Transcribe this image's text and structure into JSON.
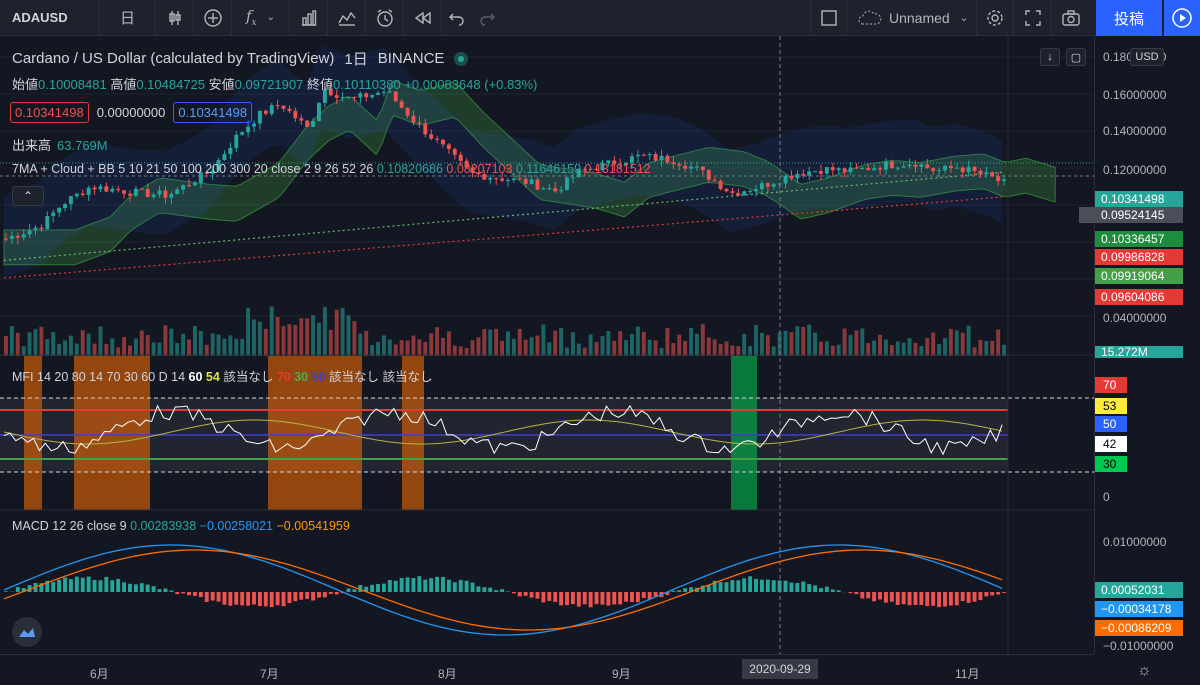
{
  "toolbar": {
    "symbol": "ADAUSD",
    "interval_icon": "日",
    "layout_name": "Unnamed",
    "post_label": "投稿"
  },
  "legend": {
    "title": "Cardano / US Dollar (calculated by TradingView)",
    "interval": "1日",
    "exchange": "BINANCE",
    "open_label": "始値",
    "open": "0.10008481",
    "high_label": "高値",
    "high": "0.10484725",
    "low_label": "安値",
    "low": "0.09721907",
    "close_label": "終値",
    "close": "0.10110380",
    "change": "+0.00083648 (+0.83%)",
    "bid": "0.10341498",
    "spread": "0.00000000",
    "ask": "0.10341498",
    "volume_label": "出来高",
    "volume": "63.769M",
    "indicator_name": "7MA + Cloud + BB 5 10 21 50 100 200 300 20 close 2 9 26 52 26",
    "ind_v1": "0.10820686",
    "ind_v2": "0.08207103",
    "ind_v3": "0.11646159",
    "ind_v4": "0.13181512",
    "collapse_icon": "chevron-up-icon"
  },
  "mfi": {
    "name": "MFI 14 20 80 14 70 30 60 D 14",
    "v60": "60",
    "v54": "54",
    "na1": "該当なし",
    "v70": "70",
    "v30": "30",
    "v50": "50",
    "na2": "該当なし",
    "na3": "該当なし",
    "tags": [
      "70",
      "53",
      "50",
      "42",
      "30"
    ],
    "zero": "0"
  },
  "macd": {
    "name": "MACD 12 26 close 9",
    "v1": "0.00283938",
    "v2": "−0.00258021",
    "v3": "−0.00541959",
    "axis": [
      "0.01000000",
      "−0.01000000"
    ],
    "tags": [
      "0.00052031",
      "−0.00034178",
      "−0.00086209"
    ]
  },
  "price_axis": {
    "currency": "USD",
    "labels": [
      "0.18000000",
      "0.16000000",
      "0.14000000",
      "0.12000000",
      "0.04000000"
    ],
    "tags": [
      "0.10341498",
      "0.09524145",
      "0.10336457",
      "0.09986828",
      "0.09919064",
      "0.09604086",
      "15.272M"
    ]
  },
  "time_axis": {
    "labels": [
      "6月",
      "7月",
      "8月",
      "9月",
      "11月"
    ],
    "crosshair_date": "2020-09-29"
  },
  "colors": {
    "bg": "#131722",
    "up": "#26a69a",
    "down": "#ef5350",
    "accent": "#2962ff"
  }
}
